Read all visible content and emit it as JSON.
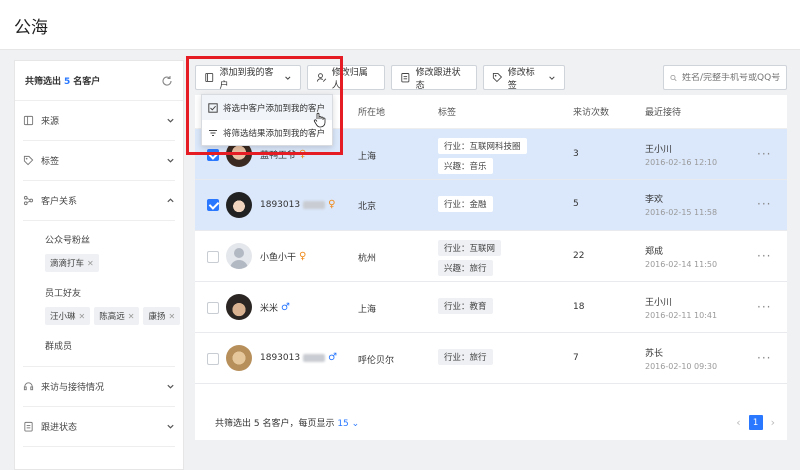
{
  "page": {
    "title": "公海"
  },
  "sidebar": {
    "summary_prefix": "共筛选出",
    "summary_count": "5",
    "summary_suffix": "名客户",
    "sections": [
      {
        "label": "来源",
        "icon": "source-icon"
      },
      {
        "label": "标签",
        "icon": "tag-icon"
      },
      {
        "label": "客户关系",
        "icon": "relation-icon"
      }
    ],
    "relation": {
      "groups": [
        {
          "title": "公众号粉丝",
          "tags": [
            "滴滴打车"
          ]
        },
        {
          "title": "员工好友",
          "tags": [
            "汪小琳",
            "陈高远",
            "康扬"
          ]
        },
        {
          "title": "群成员",
          "tags": []
        }
      ]
    },
    "bottom_sections": [
      {
        "label": "来访与接待情况",
        "icon": "headset-icon"
      },
      {
        "label": "跟进状态",
        "icon": "clipboard-icon"
      }
    ]
  },
  "toolbar": {
    "add_to_mine": "添加到我的客户",
    "change_owner": "修改归属人",
    "change_status": "修改跟进状态",
    "change_tags": "修改标签",
    "search_placeholder": "姓名/完整手机号或QQ号"
  },
  "dropdown": {
    "items": [
      "将选中客户添加到我的客户",
      "将筛选结果添加到我的客户"
    ]
  },
  "table": {
    "headers": {
      "location": "所在地",
      "tags": "标签",
      "visits": "来访次数",
      "recent": "最近接待"
    },
    "rows": [
      {
        "selected": true,
        "name": "蓝鸭王爷",
        "name_blurred": false,
        "gender": "♀",
        "location": "上海",
        "tags": [
          "行业：互联网科技圈",
          "兴趣：音乐"
        ],
        "visits": "3",
        "receiver": "王小川",
        "time": "2016-02-16  12:10"
      },
      {
        "selected": true,
        "name": "1893013",
        "name_blurred": true,
        "gender": "♀",
        "location": "北京",
        "tags": [
          "行业：金融"
        ],
        "visits": "5",
        "receiver": "李欢",
        "time": "2016-02-15  11:58"
      },
      {
        "selected": false,
        "name": "小鱼小干",
        "name_blurred": false,
        "gender": "♀",
        "location": "杭州",
        "tags": [
          "行业：互联网",
          "兴趣：旅行"
        ],
        "visits": "22",
        "receiver": "郑成",
        "time": "2016-02-14  11:50"
      },
      {
        "selected": false,
        "name": "米米",
        "name_blurred": false,
        "gender": "♂",
        "location": "上海",
        "tags": [
          "行业：教育"
        ],
        "visits": "18",
        "receiver": "王小川",
        "time": "2016-02-11  10:41"
      },
      {
        "selected": false,
        "name": "1893013",
        "name_blurred": true,
        "gender": "♂",
        "location": "呼伦贝尔",
        "tags": [
          "行业：旅行"
        ],
        "visits": "7",
        "receiver": "苏长",
        "time": "2016-02-10  09:30"
      }
    ]
  },
  "footer": {
    "summary": "共筛选出 5 名客户，每页显示",
    "per_page": "15",
    "current_page": "1"
  },
  "colors": {
    "accent": "#2a78ff",
    "female": "#f08a1a",
    "highlight": "#e51c23",
    "selected_row": "#dbe8fb"
  }
}
